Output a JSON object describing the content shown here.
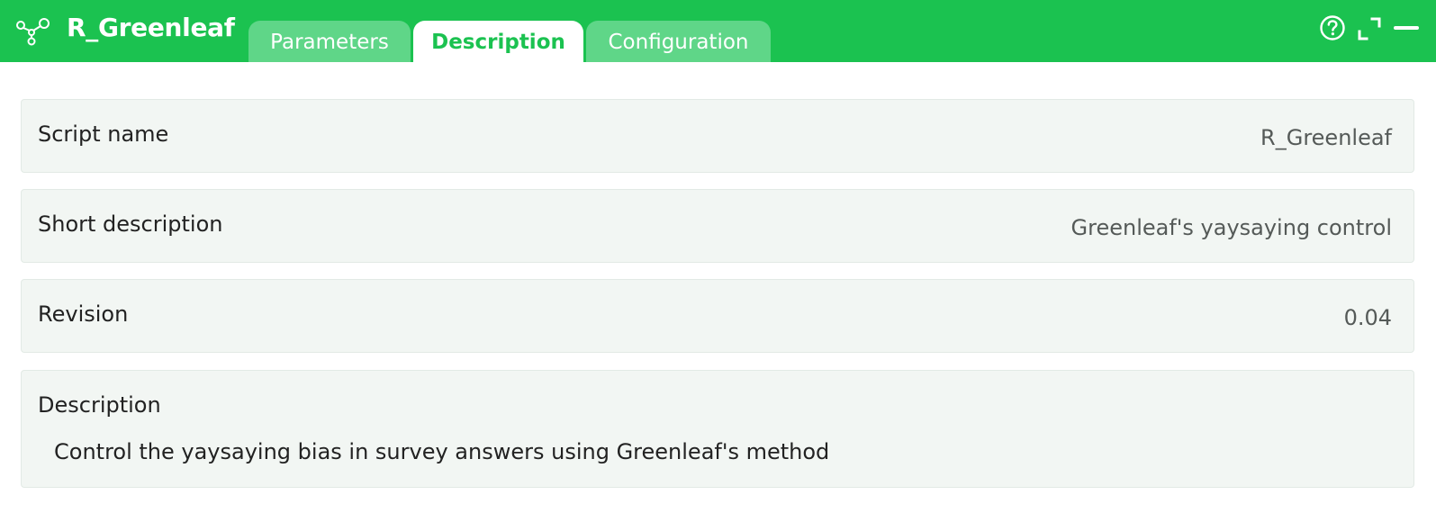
{
  "app": {
    "title": "R_Greenleaf",
    "icon": "network-nodes-icon",
    "brand_color": "#1bc250"
  },
  "tabs": [
    {
      "label": "Parameters",
      "active": false
    },
    {
      "label": "Description",
      "active": true
    },
    {
      "label": "Configuration",
      "active": false
    }
  ],
  "header_actions": {
    "help": "help-icon",
    "expand": "expand-icon",
    "minimize": "minimize-icon"
  },
  "fields": {
    "script_name": {
      "label": "Script name",
      "value": "R_Greenleaf"
    },
    "short_description": {
      "label": "Short description",
      "value": "Greenleaf's yaysaying control"
    },
    "revision": {
      "label": "Revision",
      "value": "0.04"
    },
    "description": {
      "label": "Description",
      "value": "Control the yaysaying bias in survey answers using Greenleaf's method"
    }
  }
}
